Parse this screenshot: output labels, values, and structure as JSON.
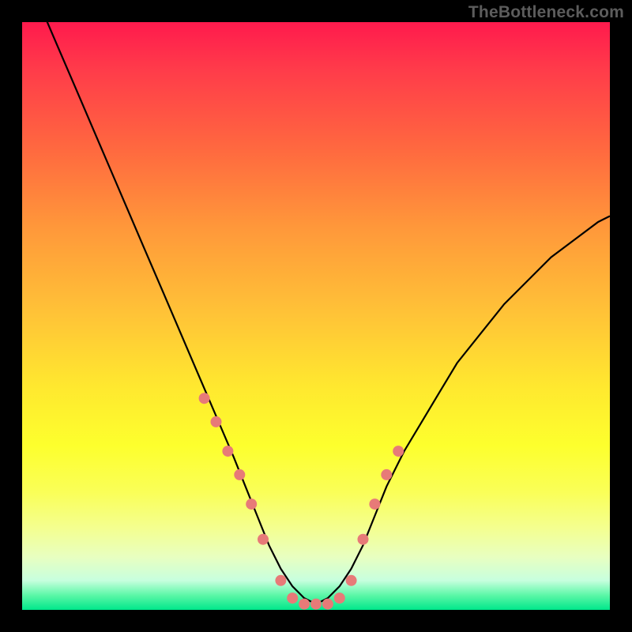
{
  "watermark": "TheBottleneck.com",
  "colors": {
    "curve": "#000000",
    "marker_fill": "#e77a78",
    "marker_stroke": "#c85f5d"
  },
  "chart_data": {
    "type": "line",
    "title": "",
    "xlabel": "",
    "ylabel": "",
    "xlim": [
      0,
      100
    ],
    "ylim": [
      0,
      100
    ],
    "x": [
      0,
      3,
      6,
      9,
      12,
      15,
      18,
      21,
      24,
      27,
      30,
      33,
      36,
      38,
      40,
      42,
      44,
      46,
      48,
      50,
      52,
      54,
      56,
      58,
      60,
      62,
      65,
      68,
      71,
      74,
      78,
      82,
      86,
      90,
      94,
      98,
      100
    ],
    "values": [
      110,
      103,
      96,
      89,
      82,
      75,
      68,
      61,
      54,
      47,
      40,
      33,
      26,
      21,
      16,
      11,
      7,
      4,
      2,
      1,
      2,
      4,
      7,
      11,
      16,
      21,
      27,
      32,
      37,
      42,
      47,
      52,
      56,
      60,
      63,
      66,
      67
    ],
    "markers_x": [
      31,
      33,
      35,
      37,
      39,
      41,
      44,
      46,
      48,
      50,
      52,
      54,
      56,
      58,
      60,
      62,
      64
    ],
    "markers_y": [
      36,
      32,
      27,
      23,
      18,
      12,
      5,
      2,
      1,
      1,
      1,
      2,
      5,
      12,
      18,
      23,
      27
    ],
    "note": "Values are percentage coordinates; x increases rightward, y increases upward from bottom of plot area."
  }
}
